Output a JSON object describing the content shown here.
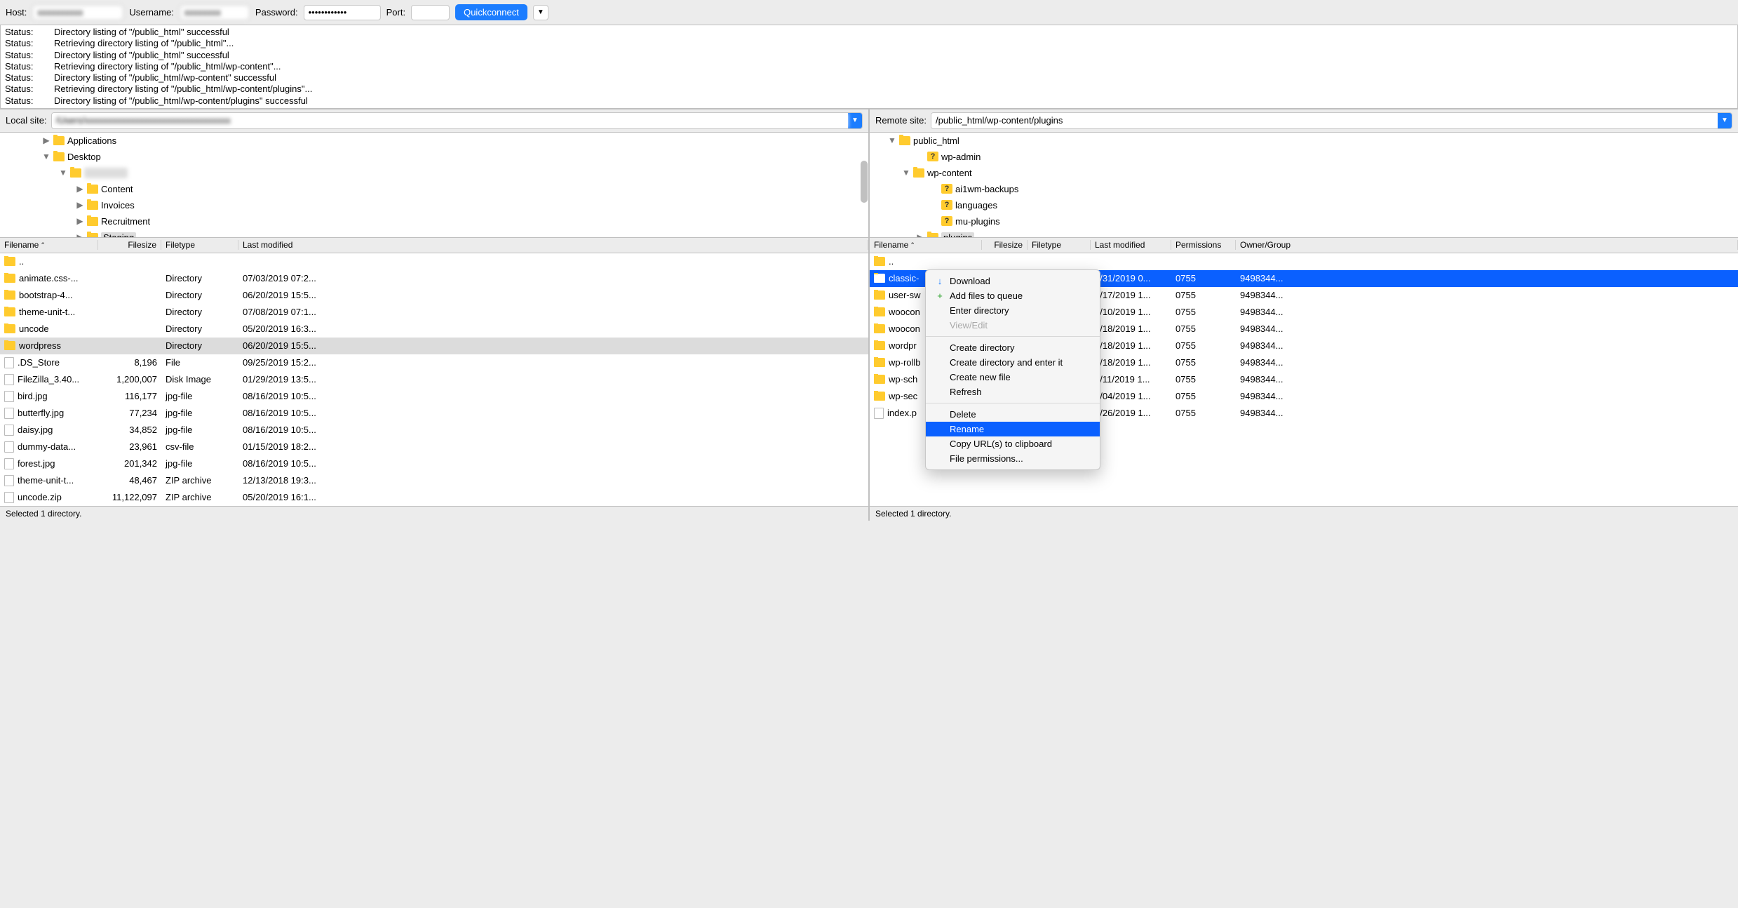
{
  "toolbar": {
    "host_label": "Host:",
    "host_value": "xxxxxxxxxx",
    "user_label": "Username:",
    "user_value": "xxxxxxxx",
    "pass_label": "Password:",
    "pass_value": "••••••••••••",
    "port_label": "Port:",
    "port_value": "",
    "quickconnect": "Quickconnect"
  },
  "log": [
    {
      "label": "Status:",
      "msg": "Directory listing of \"/public_html\" successful"
    },
    {
      "label": "Status:",
      "msg": "Retrieving directory listing of \"/public_html\"..."
    },
    {
      "label": "Status:",
      "msg": "Directory listing of \"/public_html\" successful"
    },
    {
      "label": "Status:",
      "msg": "Retrieving directory listing of \"/public_html/wp-content\"..."
    },
    {
      "label": "Status:",
      "msg": "Directory listing of \"/public_html/wp-content\" successful"
    },
    {
      "label": "Status:",
      "msg": "Retrieving directory listing of \"/public_html/wp-content/plugins\"..."
    },
    {
      "label": "Status:",
      "msg": "Directory listing of \"/public_html/wp-content/plugins\" successful"
    }
  ],
  "local": {
    "site_label": "Local site:",
    "site_value": "/Users/xxxxxxxxxxxxxxxxxxxxxxxxxxxxxxxx",
    "tree": [
      {
        "indent": 60,
        "disc": "▶",
        "kind": "folder",
        "label": "Applications"
      },
      {
        "indent": 60,
        "disc": "▼",
        "kind": "folder",
        "label": "Desktop"
      },
      {
        "indent": 84,
        "disc": "▼",
        "kind": "folder",
        "label": "xxxx xxxx",
        "blur": true
      },
      {
        "indent": 108,
        "disc": "▶",
        "kind": "folder",
        "label": "Content"
      },
      {
        "indent": 108,
        "disc": "▶",
        "kind": "folder",
        "label": "Invoices"
      },
      {
        "indent": 108,
        "disc": "▶",
        "kind": "folder",
        "label": "Recruitment"
      },
      {
        "indent": 108,
        "disc": "▶",
        "kind": "folder",
        "label": "Staging",
        "selected": true
      }
    ],
    "headers": {
      "fname": "Filename",
      "fsize": "Filesize",
      "ftype": "Filetype",
      "fmod": "Last modified"
    },
    "files": [
      {
        "icon": "folder",
        "name": "..",
        "size": "",
        "type": "",
        "mod": ""
      },
      {
        "icon": "folder",
        "name": "animate.css-...",
        "size": "",
        "type": "Directory",
        "mod": "07/03/2019 07:2..."
      },
      {
        "icon": "folder",
        "name": "bootstrap-4...",
        "size": "",
        "type": "Directory",
        "mod": "06/20/2019 15:5..."
      },
      {
        "icon": "folder",
        "name": "theme-unit-t...",
        "size": "",
        "type": "Directory",
        "mod": "07/08/2019 07:1..."
      },
      {
        "icon": "folder",
        "name": "uncode",
        "size": "",
        "type": "Directory",
        "mod": "05/20/2019 16:3..."
      },
      {
        "icon": "folder",
        "name": "wordpress",
        "size": "",
        "type": "Directory",
        "mod": "06/20/2019 15:5...",
        "selected": true
      },
      {
        "icon": "file",
        "name": ".DS_Store",
        "size": "8,196",
        "type": "File",
        "mod": "09/25/2019 15:2..."
      },
      {
        "icon": "file",
        "name": "FileZilla_3.40...",
        "size": "1,200,007",
        "type": "Disk Image",
        "mod": "01/29/2019 13:5..."
      },
      {
        "icon": "file",
        "name": "bird.jpg",
        "size": "116,177",
        "type": "jpg-file",
        "mod": "08/16/2019 10:5..."
      },
      {
        "icon": "file",
        "name": "butterfly.jpg",
        "size": "77,234",
        "type": "jpg-file",
        "mod": "08/16/2019 10:5..."
      },
      {
        "icon": "file",
        "name": "daisy.jpg",
        "size": "34,852",
        "type": "jpg-file",
        "mod": "08/16/2019 10:5..."
      },
      {
        "icon": "file",
        "name": "dummy-data...",
        "size": "23,961",
        "type": "csv-file",
        "mod": "01/15/2019 18:2..."
      },
      {
        "icon": "file",
        "name": "forest.jpg",
        "size": "201,342",
        "type": "jpg-file",
        "mod": "08/16/2019 10:5..."
      },
      {
        "icon": "file",
        "name": "theme-unit-t...",
        "size": "48,467",
        "type": "ZIP archive",
        "mod": "12/13/2018 19:3..."
      },
      {
        "icon": "file",
        "name": "uncode.zip",
        "size": "11,122,097",
        "type": "ZIP archive",
        "mod": "05/20/2019 16:1..."
      }
    ],
    "status": "Selected 1 directory."
  },
  "remote": {
    "site_label": "Remote site:",
    "site_value": "/public_html/wp-content/plugins",
    "tree": [
      {
        "indent": 26,
        "disc": "▼",
        "kind": "folder",
        "label": "public_html"
      },
      {
        "indent": 66,
        "disc": "",
        "kind": "folderq",
        "label": "wp-admin"
      },
      {
        "indent": 46,
        "disc": "▼",
        "kind": "folder",
        "label": "wp-content"
      },
      {
        "indent": 86,
        "disc": "",
        "kind": "folderq",
        "label": "ai1wm-backups"
      },
      {
        "indent": 86,
        "disc": "",
        "kind": "folderq",
        "label": "languages"
      },
      {
        "indent": 86,
        "disc": "",
        "kind": "folderq",
        "label": "mu-plugins"
      },
      {
        "indent": 66,
        "disc": "▶",
        "kind": "folder",
        "label": "plugins",
        "selected": true
      }
    ],
    "headers": {
      "fname": "Filename",
      "fsize": "Filesize",
      "ftype": "Filetype",
      "fmod": "Last modified",
      "perm": "Permissions",
      "owner": "Owner/Group"
    },
    "files": [
      {
        "icon": "folder",
        "name": "..",
        "size": "",
        "type": "",
        "mod": "",
        "perm": "",
        "owner": ""
      },
      {
        "icon": "folder",
        "name": "classic-",
        "size": "",
        "type": "",
        "mod": "7/31/2019 0...",
        "perm": "0755",
        "owner": "9498344...",
        "selected": true
      },
      {
        "icon": "folder",
        "name": "user-sw",
        "size": "",
        "type": "",
        "mod": "9/17/2019 1...",
        "perm": "0755",
        "owner": "9498344..."
      },
      {
        "icon": "folder",
        "name": "woocon",
        "size": "",
        "type": "",
        "mod": "0/10/2019 1...",
        "perm": "0755",
        "owner": "9498344..."
      },
      {
        "icon": "folder",
        "name": "woocon",
        "size": "",
        "type": "",
        "mod": "0/18/2019 1...",
        "perm": "0755",
        "owner": "9498344..."
      },
      {
        "icon": "folder",
        "name": "wordpr",
        "size": "",
        "type": "",
        "mod": "0/18/2019 1...",
        "perm": "0755",
        "owner": "9498344..."
      },
      {
        "icon": "folder",
        "name": "wp-rollb",
        "size": "",
        "type": "",
        "mod": "0/18/2019 1...",
        "perm": "0755",
        "owner": "9498344..."
      },
      {
        "icon": "folder",
        "name": "wp-sch",
        "size": "",
        "type": "",
        "mod": "0/11/2019 1...",
        "perm": "0755",
        "owner": "9498344..."
      },
      {
        "icon": "folder",
        "name": "wp-sec",
        "size": "",
        "type": "",
        "mod": "0/04/2019 1...",
        "perm": "0755",
        "owner": "9498344..."
      },
      {
        "icon": "file",
        "name": "index.p",
        "size": "",
        "type": "",
        "mod": "7/26/2019 1...",
        "perm": "0755",
        "owner": "9498344..."
      }
    ],
    "status": "Selected 1 directory."
  },
  "context_menu": [
    {
      "label": "Download",
      "icon": "↓"
    },
    {
      "label": "Add files to queue",
      "icon": "+"
    },
    {
      "label": "Enter directory",
      "disabled": false
    },
    {
      "label": "View/Edit",
      "disabled": true
    },
    {
      "sep": true
    },
    {
      "label": "Create directory"
    },
    {
      "label": "Create directory and enter it"
    },
    {
      "label": "Create new file"
    },
    {
      "label": "Refresh"
    },
    {
      "sep": true
    },
    {
      "label": "Delete"
    },
    {
      "label": "Rename",
      "highlight": true
    },
    {
      "label": "Copy URL(s) to clipboard"
    },
    {
      "label": "File permissions..."
    }
  ]
}
